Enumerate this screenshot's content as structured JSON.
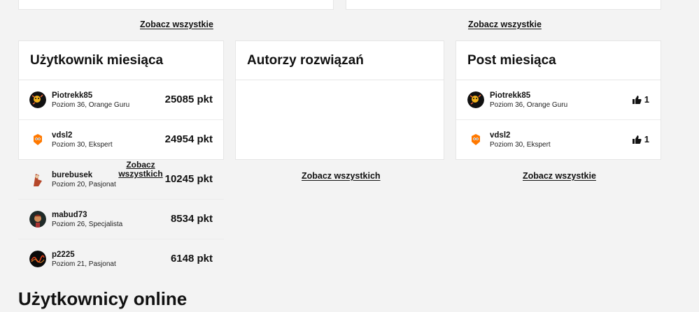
{
  "top_links": {
    "left": "Zobacz wszystkie",
    "right": "Zobacz wszystkie"
  },
  "user_of_month": {
    "title": "Użytkownik miesiąca",
    "overlap_link": "Zobacz wszystkich",
    "users": [
      {
        "name": "Piotrekk85",
        "level": "Poziom 36, Orange Guru",
        "points": "25085 pkt"
      },
      {
        "name": "vdsl2",
        "level": "Poziom 30, Ekspert",
        "points": "24954 pkt"
      },
      {
        "name": "burebusek",
        "level": "Poziom 20, Pasjonat",
        "points": "10245 pkt"
      },
      {
        "name": "mabud73",
        "level": "Poziom 26, Specjalista",
        "points": "8534 pkt"
      },
      {
        "name": "p2225",
        "level": "Poziom 21, Pasjonat",
        "points": "6148 pkt"
      }
    ]
  },
  "solution_authors": {
    "title": "Autorzy rozwiązań",
    "see_all": "Zobacz wszystkich"
  },
  "post_of_month": {
    "title": "Post miesiąca",
    "see_all": "Zobacz wszystkie",
    "posts": [
      {
        "name": "Piotrekk85",
        "level": "Poziom 36, Orange Guru",
        "likes": "1"
      },
      {
        "name": "vdsl2",
        "level": "Poziom 30, Ekspert",
        "likes": "1"
      }
    ]
  },
  "online_users": {
    "title": "Użytkownicy online"
  },
  "icons": {
    "avatar": "avatar-icon",
    "like": "thumbs-up-icon"
  },
  "colors": {
    "brand_orange": "#ff7900",
    "background": "#f3f3f3",
    "card": "#ffffff"
  }
}
